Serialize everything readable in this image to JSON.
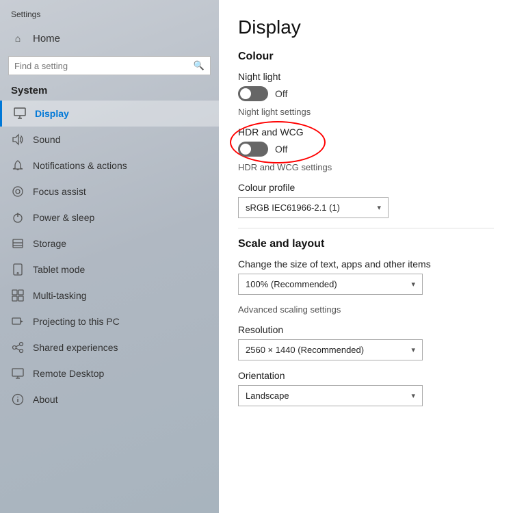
{
  "app": {
    "title": "Settings"
  },
  "sidebar": {
    "title": "Settings",
    "home": "Home",
    "search_placeholder": "Find a setting",
    "system_heading": "System",
    "nav_items": [
      {
        "id": "display",
        "label": "Display",
        "icon": "monitor",
        "active": true
      },
      {
        "id": "sound",
        "label": "Sound",
        "icon": "speaker"
      },
      {
        "id": "notifications",
        "label": "Notifications & actions",
        "icon": "bell"
      },
      {
        "id": "focus",
        "label": "Focus assist",
        "icon": "moon"
      },
      {
        "id": "power",
        "label": "Power & sleep",
        "icon": "power"
      },
      {
        "id": "storage",
        "label": "Storage",
        "icon": "storage"
      },
      {
        "id": "tablet",
        "label": "Tablet mode",
        "icon": "tablet"
      },
      {
        "id": "multitasking",
        "label": "Multi-tasking",
        "icon": "multitask"
      },
      {
        "id": "projecting",
        "label": "Projecting to this PC",
        "icon": "project"
      },
      {
        "id": "shared",
        "label": "Shared experiences",
        "icon": "shared"
      },
      {
        "id": "remote",
        "label": "Remote Desktop",
        "icon": "remote"
      },
      {
        "id": "about",
        "label": "About",
        "icon": "info"
      }
    ]
  },
  "main": {
    "page_title": "Display",
    "colour_section": {
      "heading": "Colour",
      "night_light_label": "Night light",
      "night_light_state": "Off",
      "night_light_on": false,
      "night_light_settings": "Night light settings",
      "hdr_label": "HDR and WCG",
      "hdr_state": "Off",
      "hdr_on": false,
      "hdr_settings": "HDR and WCG settings",
      "colour_profile_label": "Colour profile",
      "colour_profile_value": "sRGB IEC61966-2.1 (1)"
    },
    "scale_section": {
      "heading": "Scale and layout",
      "change_size_label": "Change the size of text, apps and other items",
      "scale_value": "100% (Recommended)",
      "advanced_scaling": "Advanced scaling settings",
      "resolution_label": "Resolution",
      "resolution_value": "2560 × 1440 (Recommended)",
      "orientation_label": "Orientation",
      "orientation_value": "Landscape"
    }
  },
  "icons": {
    "monitor": "🖥",
    "speaker": "🔊",
    "bell": "🔔",
    "moon": "☾",
    "power": "⏻",
    "storage": "💾",
    "tablet": "📱",
    "multitask": "⊞",
    "project": "📽",
    "shared": "🔗",
    "remote": "🖥",
    "info": "ℹ",
    "home": "⌂",
    "search": "🔍",
    "chevron": "▾"
  }
}
